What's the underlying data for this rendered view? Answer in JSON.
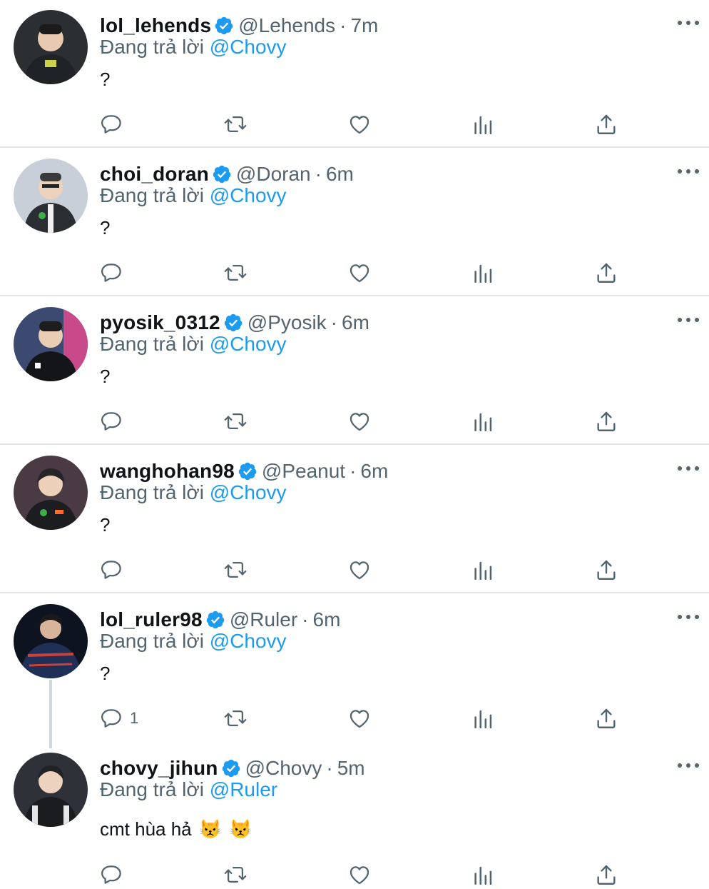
{
  "colors": {
    "accent": "#1d9bf0",
    "muted": "#536471",
    "text": "#0f1419",
    "verified": "#1d9bf0"
  },
  "icons": [
    "reply-icon",
    "retweet-icon",
    "like-icon",
    "views-icon",
    "share-icon",
    "verified-badge-icon",
    "more-icon"
  ],
  "tweets": [
    {
      "name": "lol_lehends",
      "handle": "@Lehends",
      "dot": "·",
      "time": "7m",
      "replying_prefix": "Đang trả lời",
      "replying_to": "@Chovy",
      "text": "?",
      "emojis": [],
      "reply_count": ""
    },
    {
      "name": "choi_doran",
      "handle": "@Doran",
      "dot": "·",
      "time": "6m",
      "replying_prefix": "Đang trả lời",
      "replying_to": "@Chovy",
      "text": "?",
      "emojis": [],
      "reply_count": ""
    },
    {
      "name": "pyosik_0312",
      "handle": "@Pyosik",
      "dot": "·",
      "time": "6m",
      "replying_prefix": "Đang trả lời",
      "replying_to": "@Chovy",
      "text": "?",
      "emojis": [],
      "reply_count": ""
    },
    {
      "name": "wanghohan98",
      "handle": "@Peanut",
      "dot": "·",
      "time": "6m",
      "replying_prefix": "Đang trả lời",
      "replying_to": "@Chovy",
      "text": "?",
      "emojis": [],
      "reply_count": ""
    },
    {
      "name": "lol_ruler98",
      "handle": "@Ruler",
      "dot": "·",
      "time": "6m",
      "replying_prefix": "Đang trả lời",
      "replying_to": "@Chovy",
      "text": "?",
      "emojis": [],
      "reply_count": "1"
    },
    {
      "name": "chovy_jihun",
      "handle": "@Chovy",
      "dot": "·",
      "time": "5m",
      "replying_prefix": "Đang trả lời",
      "replying_to": "@Ruler",
      "text": "cmt hùa hả",
      "emojis": [
        "😾",
        "😾"
      ],
      "reply_count": ""
    }
  ]
}
